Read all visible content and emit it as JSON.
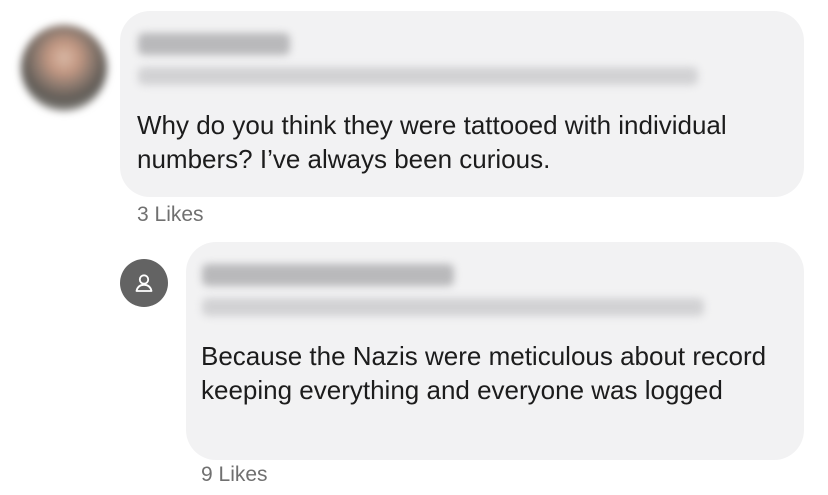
{
  "comments": [
    {
      "avatar": "profile-photo-blurred",
      "author_name": "",
      "author_headline": "",
      "text": "Why do you think they were tattooed with individual numbers? I’ve always been curious.",
      "likes_label": "3 Likes"
    },
    {
      "avatar": "person-placeholder-icon",
      "author_name": "",
      "author_headline": "",
      "text": "Because the Nazis were meticulous about record keeping everything and everyone was logged",
      "likes_label": "9 Likes"
    }
  ],
  "colors": {
    "bubble_background": "#f2f2f3",
    "text": "#1c1c1c",
    "likes_text": "#707070",
    "placeholder_avatar": "#636363"
  }
}
